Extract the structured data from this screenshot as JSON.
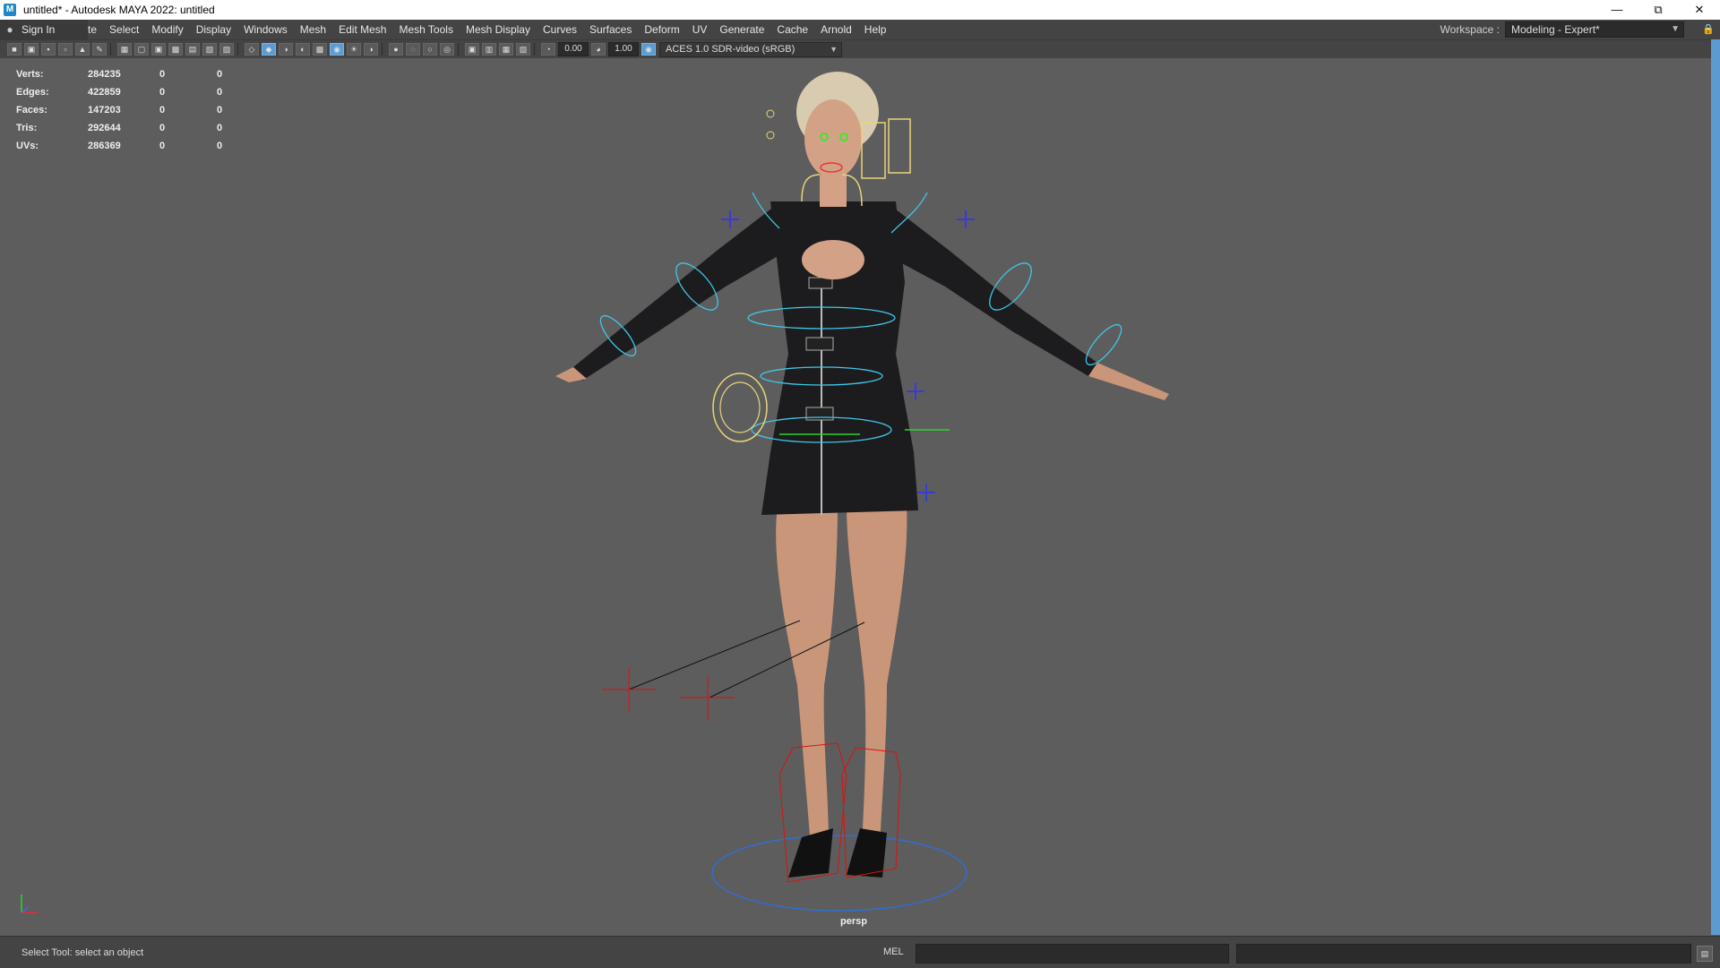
{
  "window": {
    "title": "untitled* - Autodesk MAYA 2022: untitled",
    "app_icon": "maya-icon",
    "controls": [
      "minimize",
      "restore",
      "close"
    ]
  },
  "menubar": {
    "sign_in": "Sign In",
    "partial_menu": "te",
    "menus": [
      "Select",
      "Modify",
      "Display",
      "Windows",
      "Mesh",
      "Edit Mesh",
      "Mesh Tools",
      "Mesh Display",
      "Curves",
      "Surfaces",
      "Deform",
      "UV",
      "Generate",
      "Cache",
      "Arnold",
      "Help"
    ],
    "workspace_label": "Workspace :",
    "workspace_value": "Modeling - Expert*"
  },
  "toolbar": {
    "exposure": "0.00",
    "gamma": "1.00",
    "color_management": "ACES 1.0 SDR-video (sRGB)"
  },
  "hud": {
    "rows": [
      {
        "label": "Verts:",
        "value": "284235",
        "sel": "0",
        "comp": "0"
      },
      {
        "label": "Edges:",
        "value": "422859",
        "sel": "0",
        "comp": "0"
      },
      {
        "label": "Faces:",
        "value": "147203",
        "sel": "0",
        "comp": "0"
      },
      {
        "label": "Tris:",
        "value": "292644",
        "sel": "0",
        "comp": "0"
      },
      {
        "label": "UVs:",
        "value": "286369",
        "sel": "0",
        "comp": "0"
      }
    ]
  },
  "viewport": {
    "camera": "persp"
  },
  "statusbar": {
    "help_line": "Select Tool: select an object",
    "mel_label": "MEL"
  }
}
